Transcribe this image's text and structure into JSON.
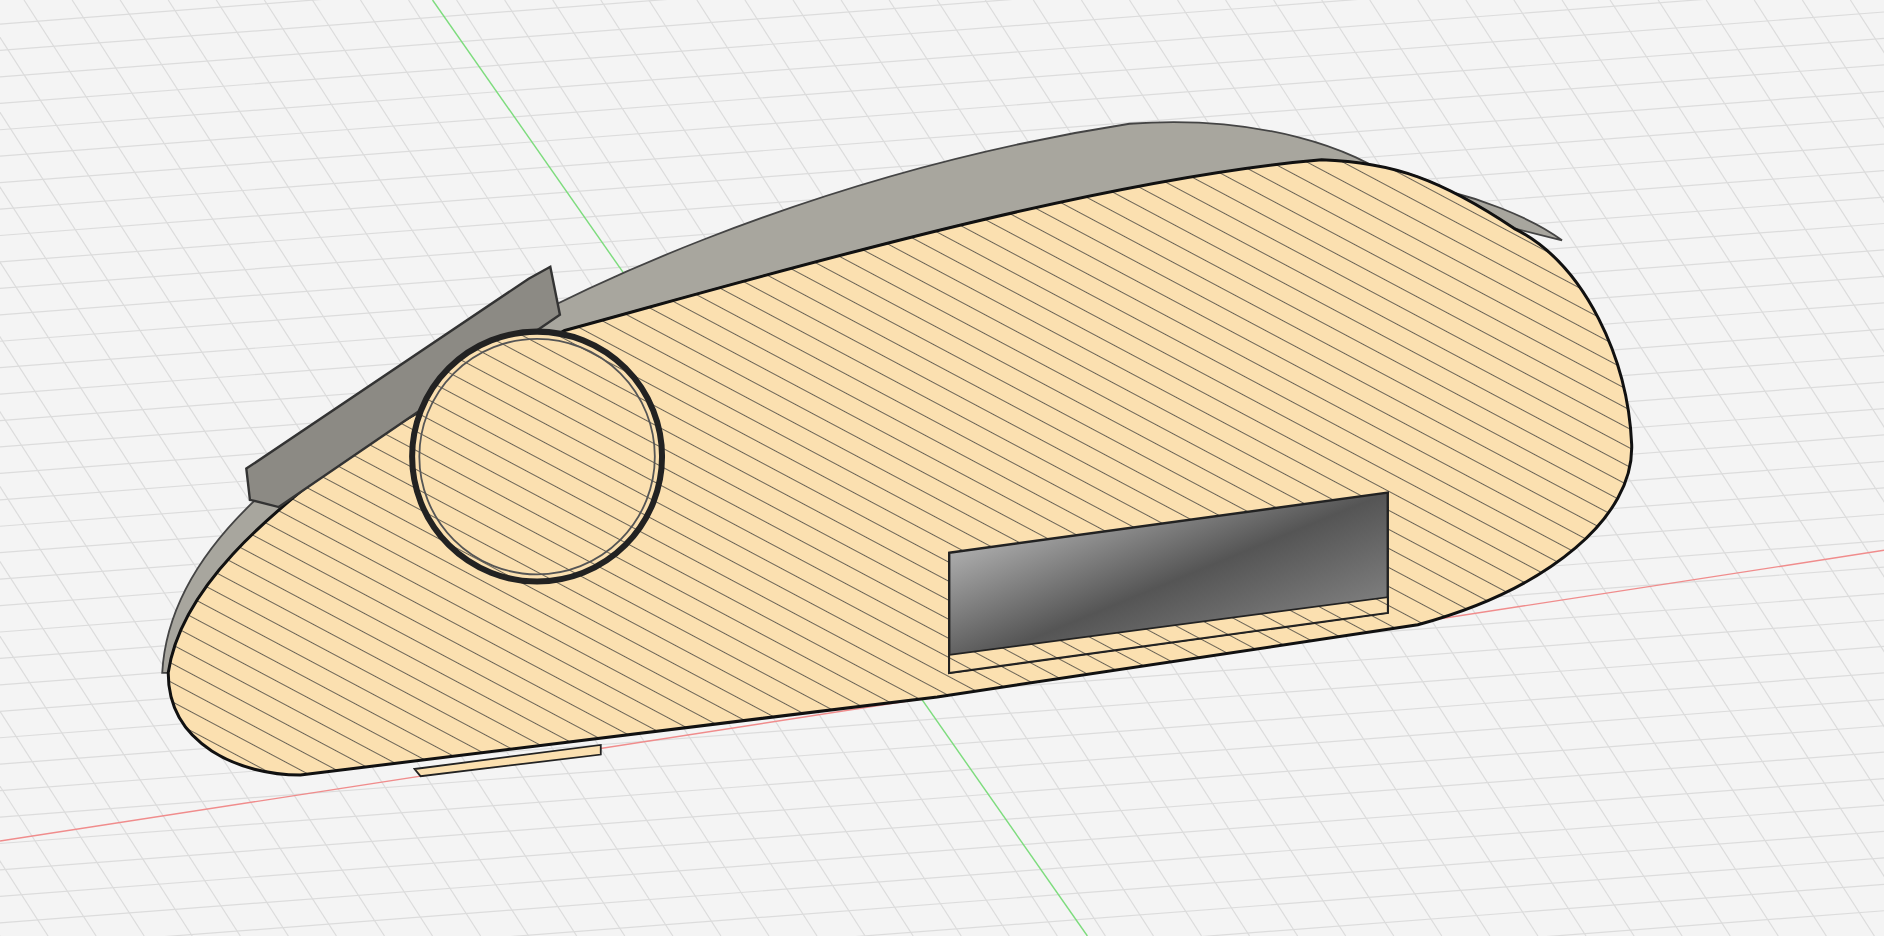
{
  "viewport": {
    "grid_visible": true,
    "axes_visible": true,
    "section_hatch": true
  }
}
